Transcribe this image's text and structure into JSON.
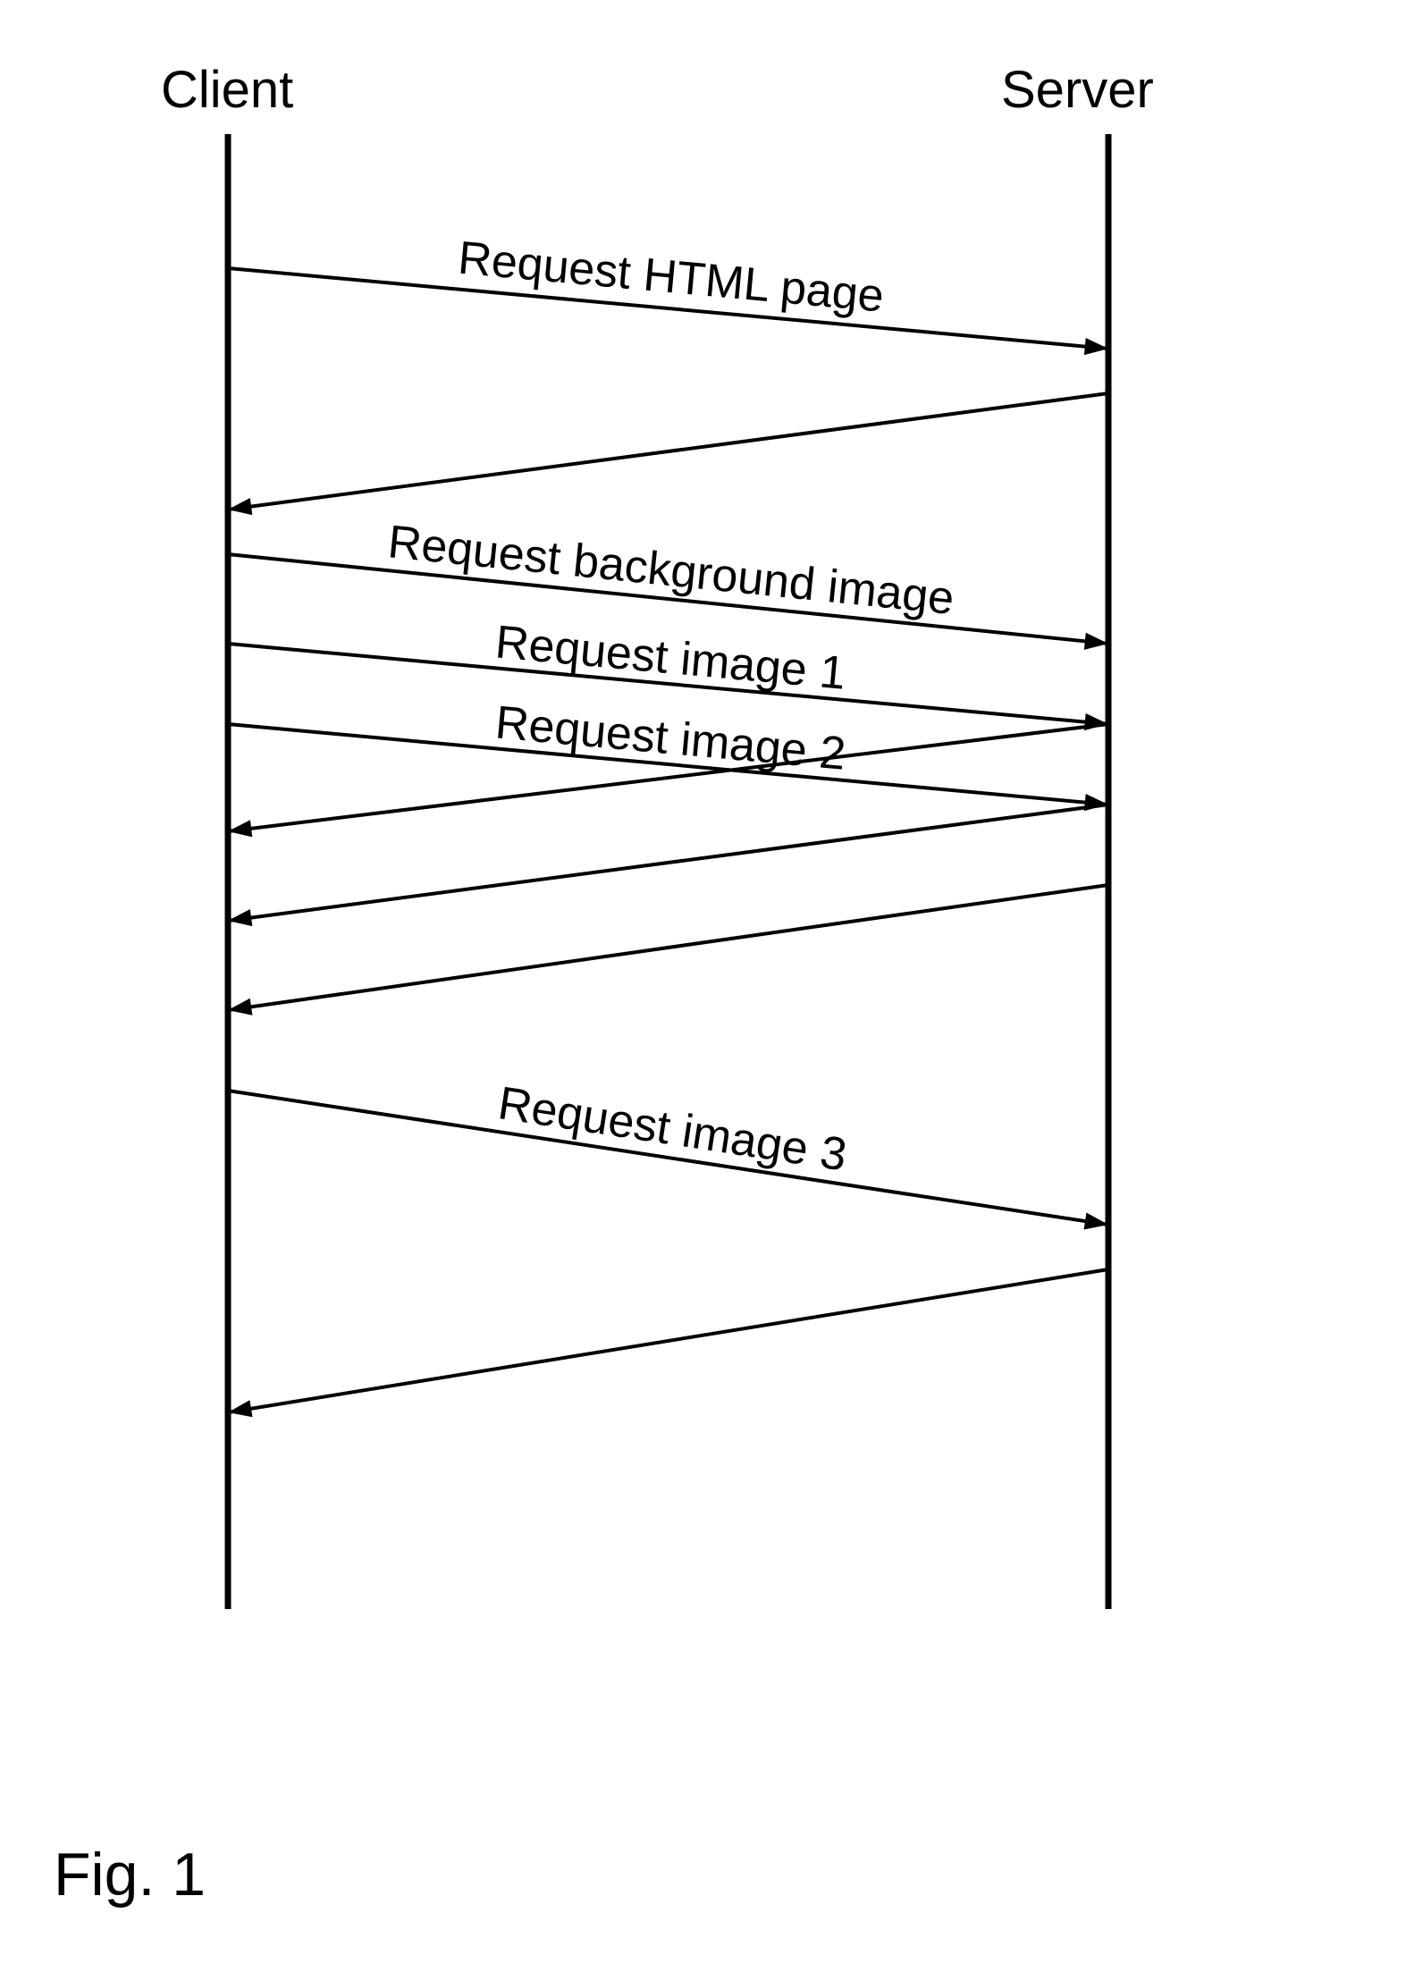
{
  "participants": {
    "client": "Client",
    "server": "Server"
  },
  "geometry": {
    "clientX": 255,
    "serverX": 1240,
    "topY": 150,
    "bottomY": 1800,
    "labelOffsetY": -30
  },
  "arrows": [
    {
      "dir": "rtl_start_left",
      "yStart": 300,
      "yEnd": 390,
      "label": "Request HTML page",
      "label_anchor": "middle",
      "label_dy": -18
    },
    {
      "dir": "ltr_start_right",
      "yStart": 440,
      "yEnd": 570,
      "label": "",
      "label_anchor": "middle",
      "label_dy": 0
    },
    {
      "dir": "rtl_start_left",
      "yStart": 620,
      "yEnd": 720,
      "label": "Request background image",
      "label_anchor": "middle",
      "label_dy": -15
    },
    {
      "dir": "rtl_start_left",
      "yStart": 720,
      "yEnd": 810,
      "label": "Request image 1",
      "label_anchor": "middle",
      "label_dy": -12
    },
    {
      "dir": "rtl_start_left",
      "yStart": 810,
      "yEnd": 900,
      "label": "Request image 2",
      "label_anchor": "middle",
      "label_dy": -12
    },
    {
      "dir": "ltr_start_right",
      "yStart": 810,
      "yEnd": 930,
      "label": "",
      "label_anchor": "middle",
      "label_dy": 0
    },
    {
      "dir": "ltr_start_right",
      "yStart": 900,
      "yEnd": 1030,
      "label": "",
      "label_anchor": "middle",
      "label_dy": 0
    },
    {
      "dir": "ltr_start_right",
      "yStart": 990,
      "yEnd": 1130,
      "label": "",
      "label_anchor": "middle",
      "label_dy": 0
    },
    {
      "dir": "rtl_start_left",
      "yStart": 1220,
      "yEnd": 1370,
      "label": "Request image 3",
      "label_anchor": "middle",
      "label_dy": -15
    },
    {
      "dir": "ltr_start_right",
      "yStart": 1420,
      "yEnd": 1580,
      "label": "",
      "label_anchor": "middle",
      "label_dy": 0
    }
  ],
  "caption": "Fig. 1"
}
